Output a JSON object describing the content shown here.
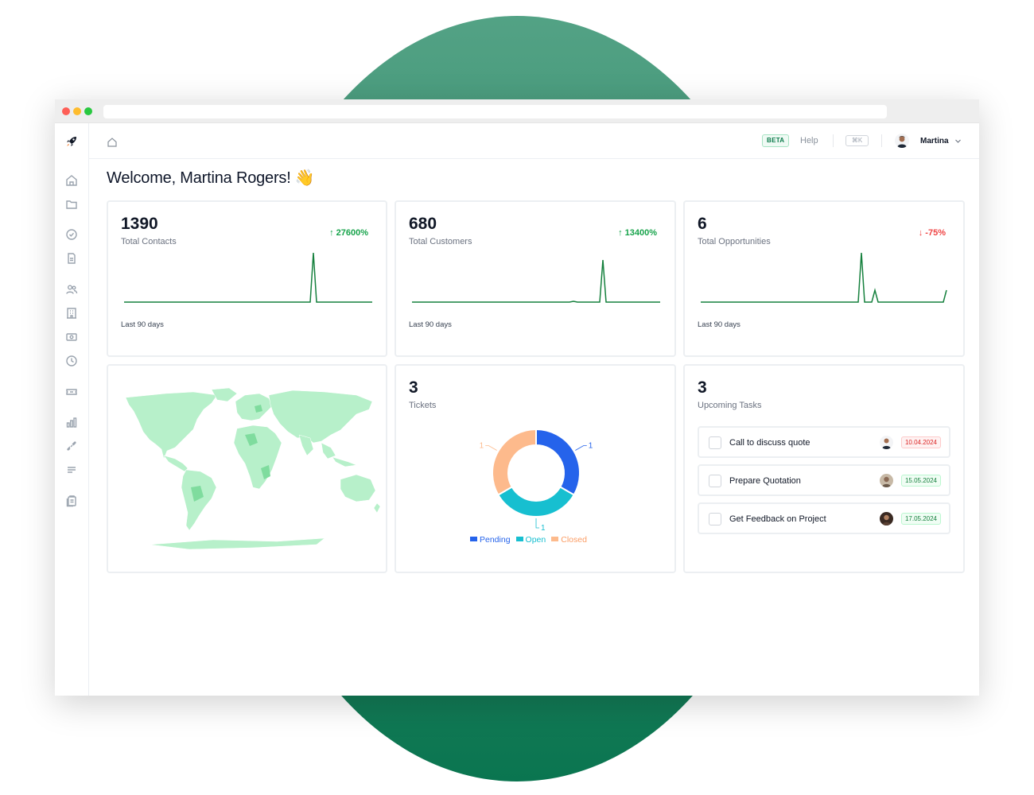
{
  "topbar": {
    "beta_label": "BETA",
    "help_label": "Help",
    "shortcut": "⌘K",
    "user_name": "Martina"
  },
  "welcome": "Welcome, Martina Rogers! 👋",
  "stats": [
    {
      "value": "1390",
      "label": "Total Contacts",
      "trend": "↑ 27600%",
      "trend_dir": "up",
      "period": "Last 90 days"
    },
    {
      "value": "680",
      "label": "Total Customers",
      "trend": "↑ 13400%",
      "trend_dir": "up",
      "period": "Last 90 days"
    },
    {
      "value": "6",
      "label": "Total Opportunities",
      "trend": "↓ -75%",
      "trend_dir": "down",
      "period": "Last 90 days"
    }
  ],
  "tickets": {
    "value": "3",
    "label": "Tickets",
    "chart_data": {
      "type": "pie",
      "categories": [
        "Pending",
        "Open",
        "Closed"
      ],
      "values": [
        1,
        1,
        1
      ],
      "colors": [
        "#2563eb",
        "#17bfd0",
        "#fdba8c"
      ],
      "data_labels": [
        "1",
        "1",
        "1"
      ]
    }
  },
  "tasks": {
    "value": "3",
    "label": "Upcoming Tasks",
    "items": [
      {
        "title": "Call to discuss quote",
        "date": "10.04.2024",
        "status": "overdue"
      },
      {
        "title": "Prepare Quotation",
        "date": "15.05.2024",
        "status": "upcoming"
      },
      {
        "title": "Get Feedback on Project",
        "date": "17.05.2024",
        "status": "upcoming"
      }
    ]
  },
  "colors": {
    "accent": "#0a7a4a",
    "spark_line": "#15803d",
    "map_land": "#b7f0ca",
    "map_highlight": "#7fdc9e"
  }
}
